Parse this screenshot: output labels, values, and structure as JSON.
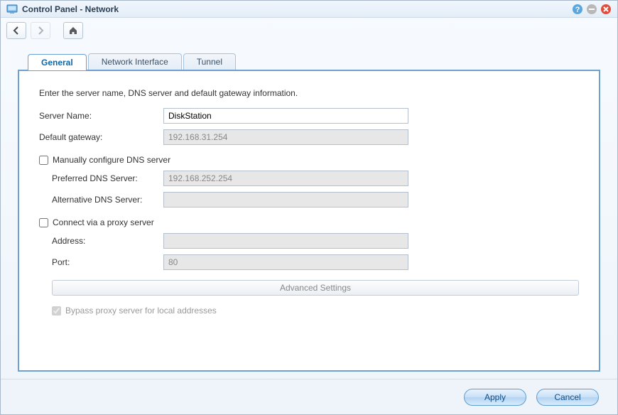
{
  "titlebar": {
    "title": "Control Panel - Network"
  },
  "tabs": {
    "general": "General",
    "network_interface": "Network Interface",
    "tunnel": "Tunnel"
  },
  "form": {
    "instruction": "Enter the server name, DNS server and default gateway information.",
    "server_name_label": "Server Name:",
    "server_name_value": "DiskStation",
    "default_gateway_label": "Default gateway:",
    "default_gateway_value": "192.168.31.254",
    "manual_dns_label": "Manually configure DNS server",
    "preferred_dns_label": "Preferred DNS Server:",
    "preferred_dns_value": "192.168.252.254",
    "alternative_dns_label": "Alternative DNS Server:",
    "alternative_dns_value": "",
    "proxy_label": "Connect via a proxy server",
    "proxy_address_label": "Address:",
    "proxy_address_value": "",
    "proxy_port_label": "Port:",
    "proxy_port_value": "80",
    "advanced_settings_label": "Advanced Settings",
    "bypass_proxy_label": "Bypass proxy server for local addresses"
  },
  "footer": {
    "apply": "Apply",
    "cancel": "Cancel"
  }
}
